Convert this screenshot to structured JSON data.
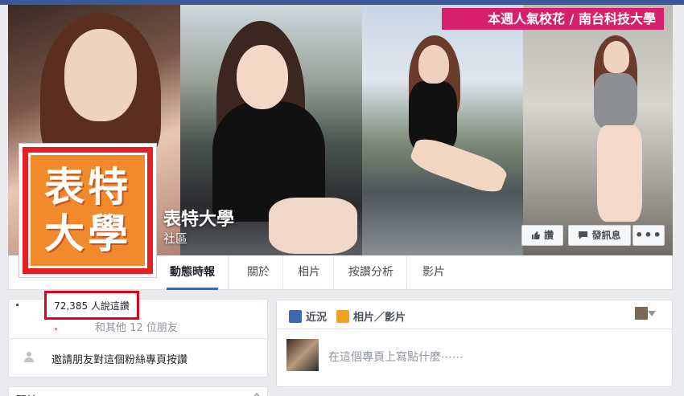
{
  "cover": {
    "banner_text": "本週人氣校花 / 南台科技大學"
  },
  "page": {
    "name": "表特大學",
    "category": "社區",
    "logo_lines": [
      "表特",
      "大學"
    ]
  },
  "actions": {
    "like_label": "讚",
    "message_label": "發訊息",
    "more_label": "•••"
  },
  "tabs": [
    {
      "label": "動態時報",
      "active": true
    },
    {
      "label": "關於"
    },
    {
      "label": "相片"
    },
    {
      "label": "按讚分析"
    },
    {
      "label": "影片"
    }
  ],
  "sidebar": {
    "likes_text": "72,385 人說這讚",
    "friends_text": "和其他 12 位朋友",
    "invite_text": "邀請朋友對這個粉絲專頁按讚",
    "next_section_label": "關於"
  },
  "composer": {
    "tab_status": "近況",
    "tab_photo": "相片／影片",
    "placeholder": "在這個專頁上寫點什麼⋯⋯"
  },
  "colors": {
    "facebook_blue": "#3b5998",
    "banner_pink": "#d81f6b",
    "highlight_red": "#e0001a",
    "logo_orange": "#f08a2b"
  }
}
